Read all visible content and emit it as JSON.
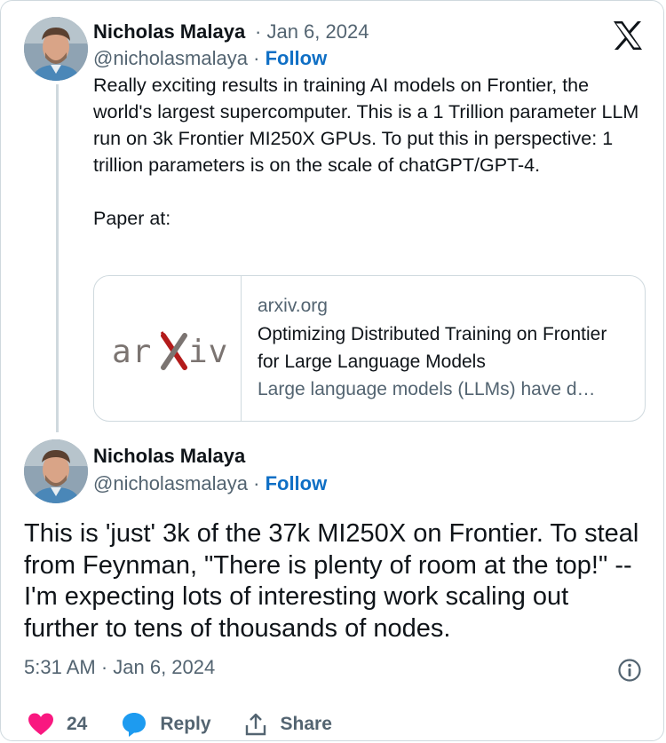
{
  "colors": {
    "accent": "#0f6fc5",
    "muted": "#536471",
    "like": "#f91880",
    "border": "#cfd9de"
  },
  "tweet": {
    "author": "Nicholas Malaya",
    "separator": "·",
    "date": "Jan 6, 2024",
    "handle": "@nicholasmalaya",
    "follow_label": "Follow",
    "text": "Really exciting results in training AI models on Frontier, the world's largest supercomputer. This is a 1 Trillion parameter LLM run on 3k Frontier MI250X GPUs. To put this in perspective: 1 trillion parameters is on the scale of chatGPT/GPT-4.\n\nPaper at:",
    "link_card": {
      "logo_text_left": "ar",
      "logo_text_right": "iv",
      "domain": "arxiv.org",
      "title": "Optimizing Distributed Training on Frontier for Large Language Models",
      "description": "Large language models (LLMs) have d…"
    }
  },
  "reply": {
    "author": "Nicholas Malaya",
    "separator": "·",
    "handle": "@nicholasmalaya",
    "follow_label": "Follow",
    "text": "This is 'just' 3k of the 37k MI250X on Frontier. To steal from Feynman, \"There is plenty of room at the top!\"  -- I'm expecting lots of interesting work scaling out further to tens of thousands of nodes.",
    "timestamp": "5:31 AM · Jan 6, 2024"
  },
  "actions": {
    "like_count": "24",
    "reply_label": "Reply",
    "share_label": "Share"
  },
  "icons": [
    "x-logo-icon",
    "info-icon",
    "heart-icon",
    "reply-bubble-icon",
    "share-icon"
  ]
}
